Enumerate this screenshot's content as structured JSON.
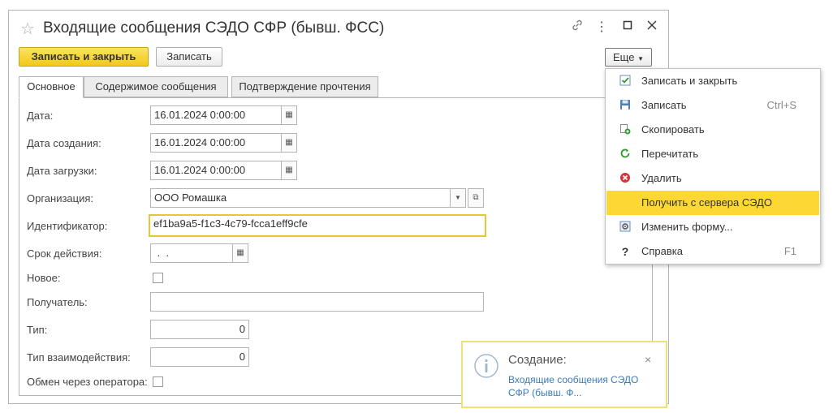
{
  "window": {
    "title": "Входящие сообщения СЭДО СФР (бывш. ФСС)",
    "icons": [
      "star-icon",
      "link-icon",
      "more-vertical-icon",
      "maximize-icon",
      "close-icon"
    ]
  },
  "toolbar": {
    "save_close_label": "Записать и закрыть",
    "save_label": "Записать",
    "more_label": "Еще"
  },
  "tabs": [
    {
      "label": "Основное",
      "active": true
    },
    {
      "label": "Содержимое сообщения",
      "active": false
    },
    {
      "label": "Подтверждение прочтения",
      "active": false
    }
  ],
  "form": {
    "date": {
      "label": "Дата:",
      "value": "16.01.2024  0:00:00"
    },
    "created": {
      "label": "Дата создания:",
      "value": "16.01.2024  0:00:00"
    },
    "loaded": {
      "label": "Дата загрузки:",
      "value": "16.01.2024  0:00:00"
    },
    "organization": {
      "label": "Организация:",
      "value": "ООО Ромашка"
    },
    "identifier": {
      "label": "Идентификатор:",
      "value": "ef1ba9a5-f1c3-4c79-fcca1eff9cfe"
    },
    "validity": {
      "label": "Срок действия:",
      "value": " .  ."
    },
    "new": {
      "label": "Новое:"
    },
    "recipient": {
      "label": "Получатель:",
      "value": ""
    },
    "type": {
      "label": "Тип:",
      "value": "0"
    },
    "interaction_type": {
      "label": "Тип взаимодействия:",
      "value": "0"
    },
    "via_operator": {
      "label": "Обмен через оператора:"
    }
  },
  "menu": {
    "items": [
      {
        "label": "Записать и закрыть",
        "shortcut": "",
        "icon": "save-close-icon"
      },
      {
        "label": "Записать",
        "shortcut": "Ctrl+S",
        "icon": "floppy-icon"
      },
      {
        "label": "Скопировать",
        "shortcut": "",
        "icon": "copy-icon"
      },
      {
        "label": "Перечитать",
        "shortcut": "",
        "icon": "refresh-icon"
      },
      {
        "label": "Удалить",
        "shortcut": "",
        "icon": "delete-icon"
      },
      {
        "label": "Получить с сервера СЭДО",
        "shortcut": "",
        "icon": "",
        "selected": true
      },
      {
        "label": "Изменить форму...",
        "shortcut": "",
        "icon": "form-settings-icon"
      },
      {
        "label": "Справка",
        "shortcut": "F1",
        "icon": "help-icon"
      }
    ]
  },
  "toast": {
    "title": "Создание:",
    "link": "Входящие сообщения СЭДО СФР (бывш. Ф...",
    "icon": "info-icon"
  },
  "colors": {
    "primary_button": "#f2c81a",
    "selected_menu": "#fdd835",
    "focus_border": "#e8c63a",
    "link": "#3a7bbf"
  }
}
